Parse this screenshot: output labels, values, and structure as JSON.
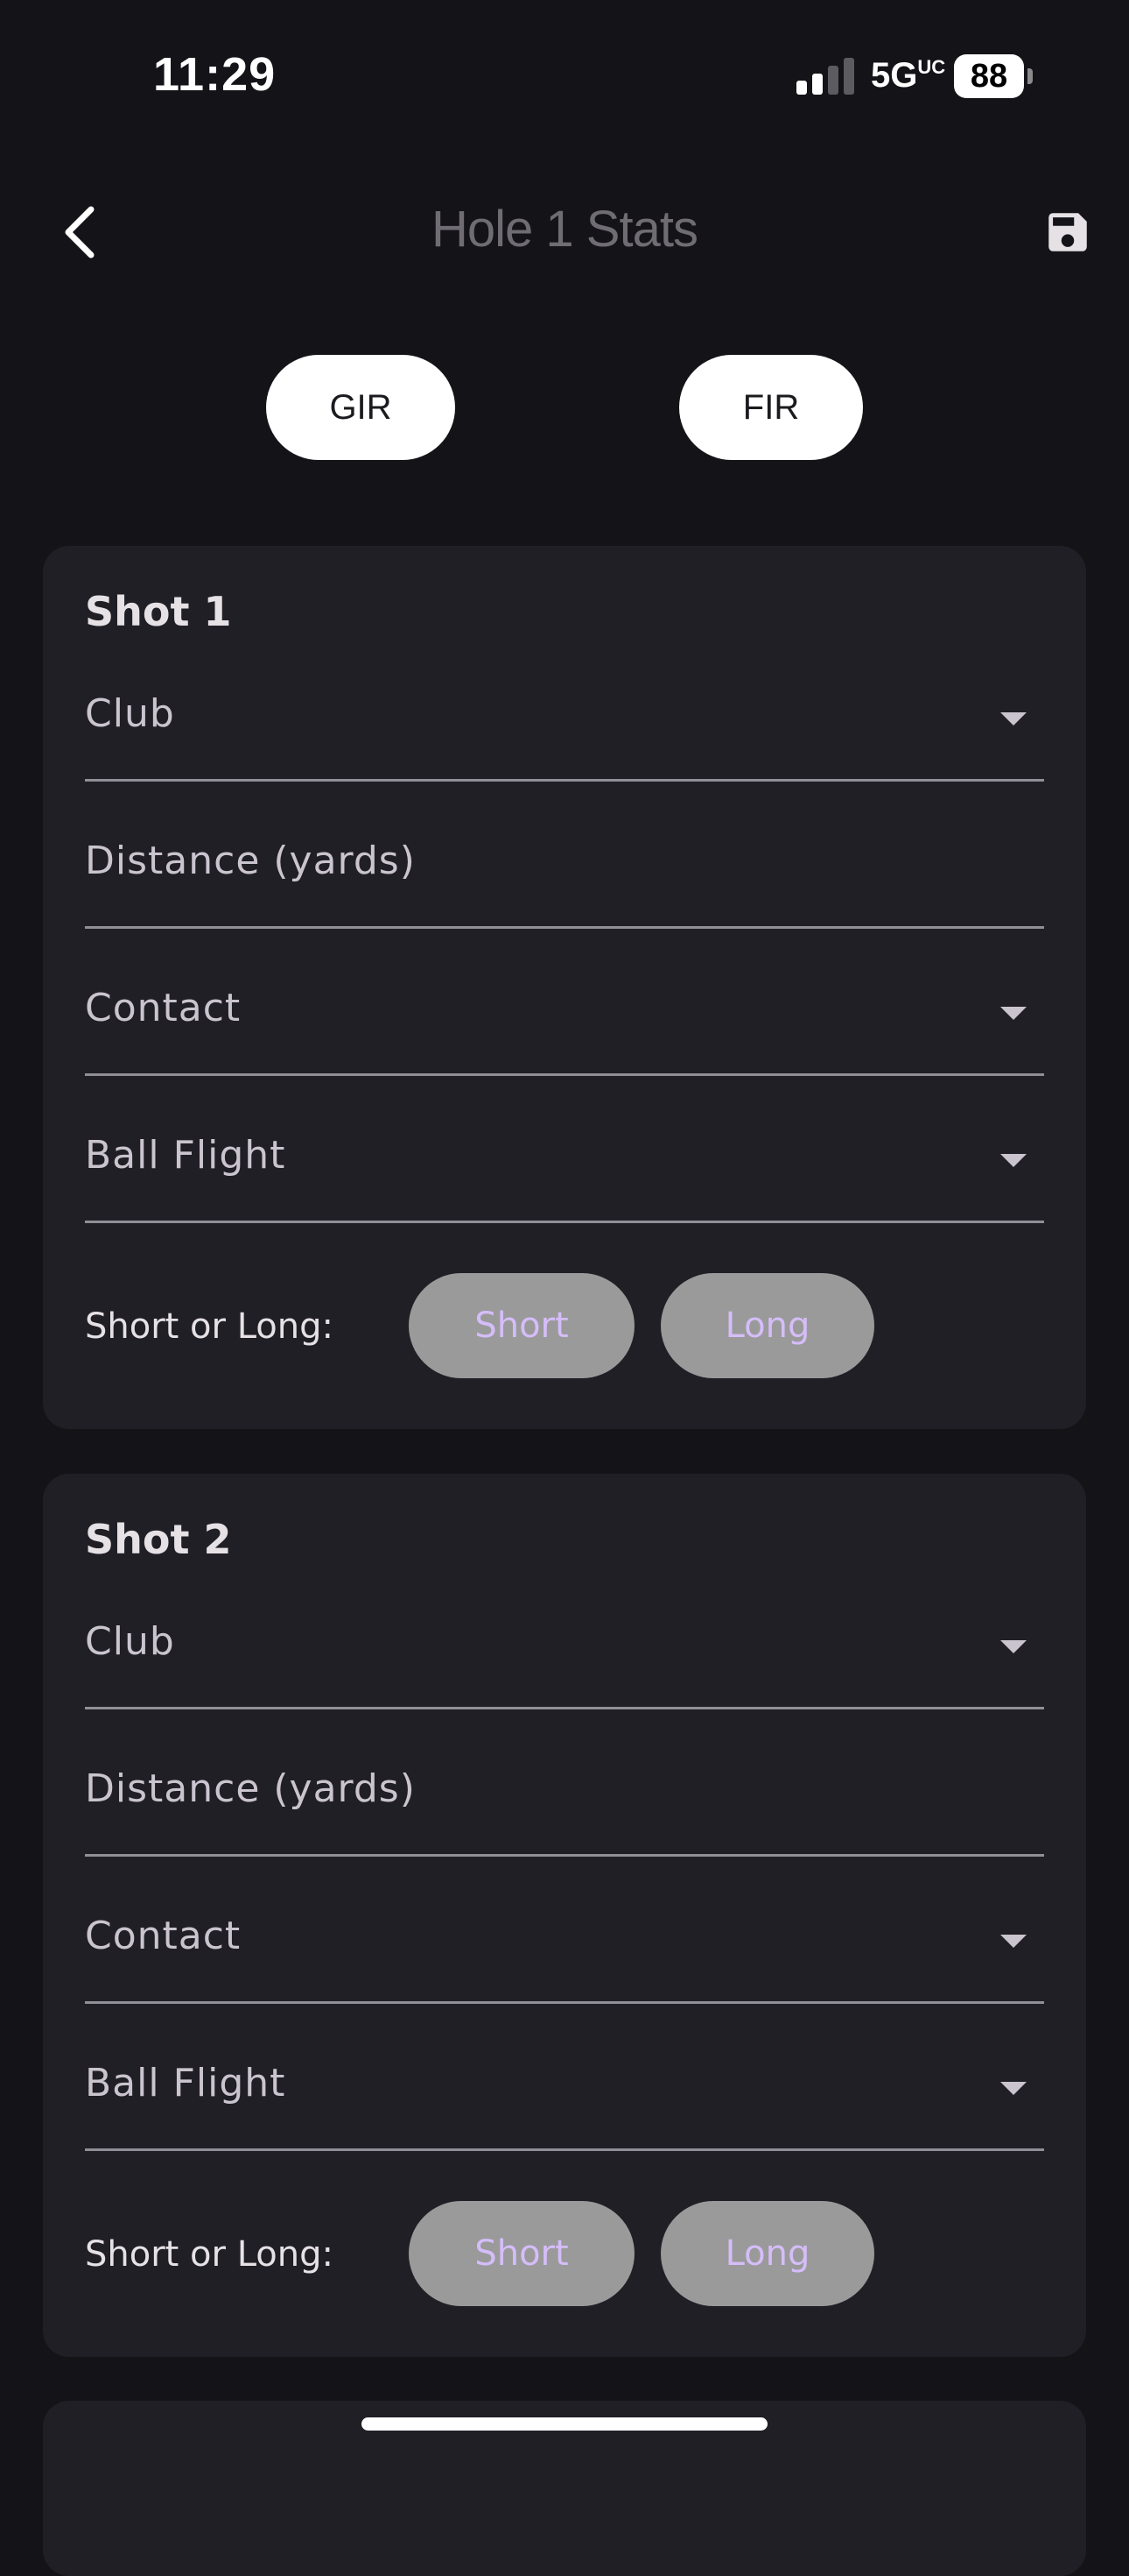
{
  "status_bar": {
    "time": "11:29",
    "network": "5G",
    "network_suffix": "UC",
    "battery": "88"
  },
  "header": {
    "title": "Hole 1 Stats",
    "back_icon": "chevron-left-icon",
    "save_icon": "save-icon"
  },
  "toggles": {
    "gir_label": "GIR",
    "fir_label": "FIR"
  },
  "shots": [
    {
      "title": "Shot 1",
      "fields": [
        "Club",
        "Distance (yards)",
        "Contact",
        "Ball Flight"
      ],
      "short_or_long_label": "Short or Long:",
      "short_label": "Short",
      "long_label": "Long"
    },
    {
      "title": "Shot 2",
      "fields": [
        "Club",
        "Distance (yards)",
        "Contact",
        "Ball Flight"
      ],
      "short_or_long_label": "Short or Long:",
      "short_label": "Short",
      "long_label": "Long"
    }
  ],
  "colors": {
    "background": "#141318",
    "card": "#201f25",
    "pill_grey": "#9a9a9a",
    "pill_text_accent": "#d5bdf9"
  }
}
